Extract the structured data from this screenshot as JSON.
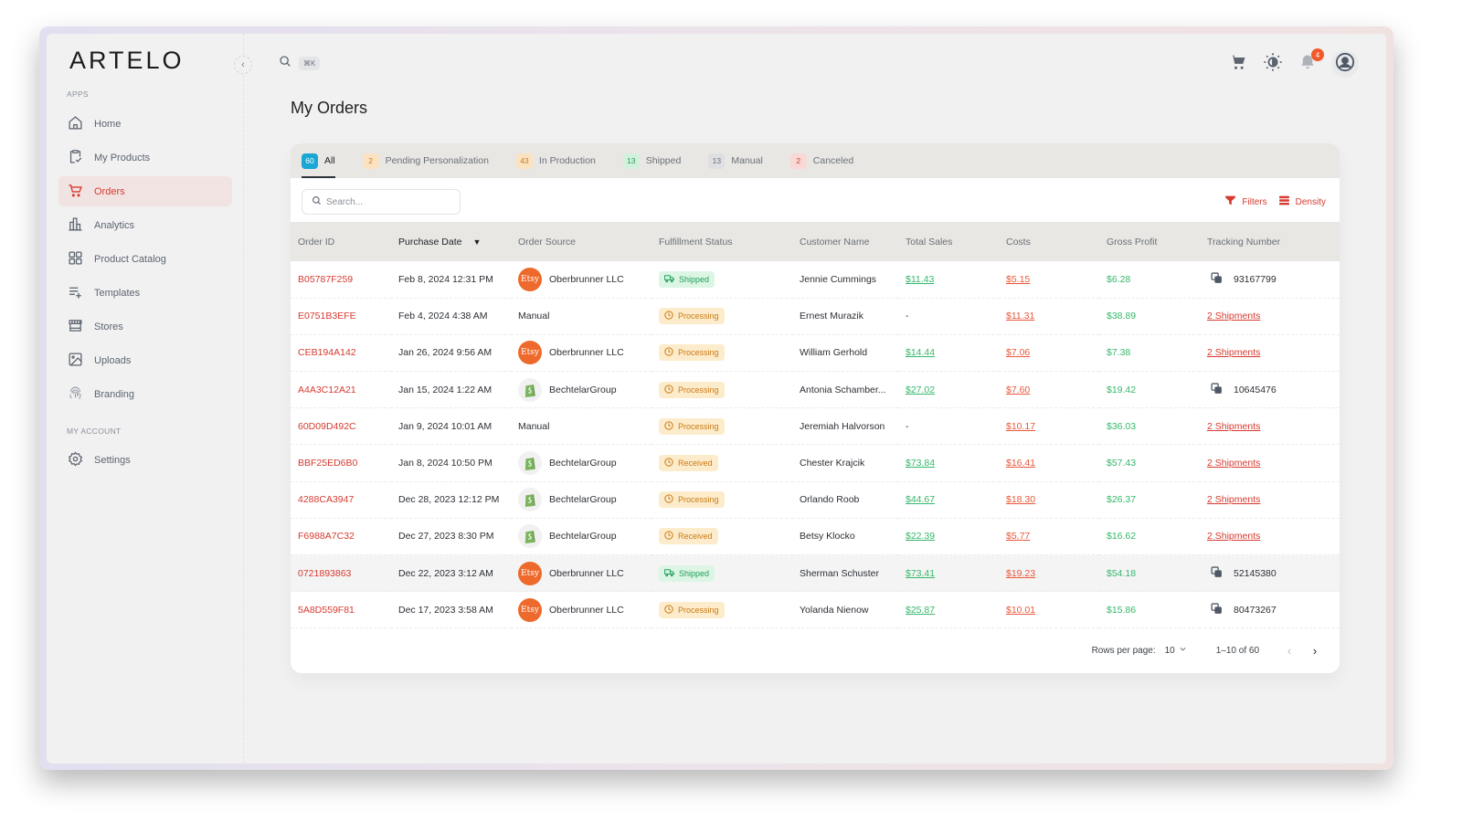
{
  "app": {
    "logo": "ARTELO",
    "search_shortcut": "⌘K",
    "notification_count": "4"
  },
  "sidebar": {
    "apps_label": "APPS",
    "account_label": "MY ACCOUNT",
    "items": [
      {
        "label": "Home",
        "icon": "home-icon"
      },
      {
        "label": "My Products",
        "icon": "clipboard-check-icon"
      },
      {
        "label": "Orders",
        "icon": "cart-icon",
        "active": true
      },
      {
        "label": "Analytics",
        "icon": "bar-chart-icon"
      },
      {
        "label": "Product Catalog",
        "icon": "grid-icon"
      },
      {
        "label": "Templates",
        "icon": "list-plus-icon"
      },
      {
        "label": "Stores",
        "icon": "storefront-icon"
      },
      {
        "label": "Uploads",
        "icon": "image-icon"
      },
      {
        "label": "Branding",
        "icon": "fingerprint-icon"
      }
    ],
    "account_items": [
      {
        "label": "Settings",
        "icon": "gear-icon"
      }
    ]
  },
  "page": {
    "title": "My Orders"
  },
  "tabs": [
    {
      "label": "All",
      "count": "60",
      "count_bg": "#1aa7d4",
      "count_color": "#ffffff",
      "active": true
    },
    {
      "label": "Pending Personalization",
      "count": "2",
      "count_bg": "#fbe3c2",
      "count_color": "#c97a17"
    },
    {
      "label": "In Production",
      "count": "43",
      "count_bg": "#fbe3c2",
      "count_color": "#c97a17"
    },
    {
      "label": "Shipped",
      "count": "13",
      "count_bg": "#d3f0dc",
      "count_color": "#22a05a"
    },
    {
      "label": "Manual",
      "count": "13",
      "count_bg": "#dedfe1",
      "count_color": "#6b7280"
    },
    {
      "label": "Canceled",
      "count": "2",
      "count_bg": "#f8d9d6",
      "count_color": "#d63a2f"
    }
  ],
  "toolbar": {
    "search_placeholder": "Search...",
    "filters_label": "Filters",
    "density_label": "Density"
  },
  "table": {
    "columns": [
      "Order ID",
      "Purchase Date",
      "Order Source",
      "Fulfillment Status",
      "Customer Name",
      "Total Sales",
      "Costs",
      "Gross Profit",
      "Tracking Number"
    ],
    "sorted_column": "Purchase Date",
    "rows": [
      {
        "order_id": "B05787F259",
        "date": "Feb 8, 2024 12:31 PM",
        "source": "Oberbrunner LLC",
        "source_type": "etsy",
        "status": "Shipped",
        "status_type": "shipped",
        "customer": "Jennie Cummings",
        "total": "$11.43",
        "costs": "$5.15",
        "profit": "$6.28",
        "tracking": "93167799",
        "tracking_type": "number"
      },
      {
        "order_id": "E0751B3EFE",
        "date": "Feb 4, 2024 4:38 AM",
        "source": "Manual",
        "source_type": "manual",
        "status": "Processing",
        "status_type": "processing",
        "customer": "Ernest Murazik",
        "total": "-",
        "costs": "$11.31",
        "profit": "$38.89",
        "tracking": "2 Shipments",
        "tracking_type": "link"
      },
      {
        "order_id": "CEB194A142",
        "date": "Jan 26, 2024 9:56 AM",
        "source": "Oberbrunner LLC",
        "source_type": "etsy",
        "status": "Processing",
        "status_type": "processing",
        "customer": "William Gerhold",
        "total": "$14.44",
        "costs": "$7.06",
        "profit": "$7.38",
        "tracking": "2 Shipments",
        "tracking_type": "link"
      },
      {
        "order_id": "A4A3C12A21",
        "date": "Jan 15, 2024 1:22 AM",
        "source": "BechtelarGroup",
        "source_type": "shopify",
        "status": "Processing",
        "status_type": "processing",
        "customer": "Antonia Schamber...",
        "total": "$27.02",
        "costs": "$7.60",
        "profit": "$19.42",
        "tracking": "10645476",
        "tracking_type": "number"
      },
      {
        "order_id": "60D09D492C",
        "date": "Jan 9, 2024 10:01 AM",
        "source": "Manual",
        "source_type": "manual",
        "status": "Processing",
        "status_type": "processing",
        "customer": "Jeremiah Halvorson",
        "total": "-",
        "costs": "$10.17",
        "profit": "$36.03",
        "tracking": "2 Shipments",
        "tracking_type": "link"
      },
      {
        "order_id": "BBF25ED6B0",
        "date": "Jan 8, 2024 10:50 PM",
        "source": "BechtelarGroup",
        "source_type": "shopify",
        "status": "Received",
        "status_type": "received",
        "customer": "Chester Krajcik",
        "total": "$73.84",
        "costs": "$16.41",
        "profit": "$57.43",
        "tracking": "2 Shipments",
        "tracking_type": "link"
      },
      {
        "order_id": "4288CA3947",
        "date": "Dec 28, 2023 12:12 PM",
        "source": "BechtelarGroup",
        "source_type": "shopify",
        "status": "Processing",
        "status_type": "processing",
        "customer": "Orlando Roob",
        "total": "$44.67",
        "costs": "$18.30",
        "profit": "$26.37",
        "tracking": "2 Shipments",
        "tracking_type": "link"
      },
      {
        "order_id": "F6988A7C32",
        "date": "Dec 27, 2023 8:30 PM",
        "source": "BechtelarGroup",
        "source_type": "shopify",
        "status": "Received",
        "status_type": "received",
        "customer": "Betsy Klocko",
        "total": "$22.39",
        "costs": "$5.77",
        "profit": "$16.62",
        "tracking": "2 Shipments",
        "tracking_type": "link"
      },
      {
        "order_id": "0721893863",
        "date": "Dec 22, 2023 3:12 AM",
        "source": "Oberbrunner LLC",
        "source_type": "etsy",
        "status": "Shipped",
        "status_type": "shipped",
        "customer": "Sherman Schuster",
        "total": "$73.41",
        "costs": "$19.23",
        "profit": "$54.18",
        "tracking": "52145380",
        "tracking_type": "number",
        "highlighted": true
      },
      {
        "order_id": "5A8D559F81",
        "date": "Dec 17, 2023 3:58 AM",
        "source": "Oberbrunner LLC",
        "source_type": "etsy",
        "status": "Processing",
        "status_type": "processing",
        "customer": "Yolanda Nienow",
        "total": "$25.87",
        "costs": "$10.01",
        "profit": "$15.86",
        "tracking": "80473267",
        "tracking_type": "number"
      }
    ]
  },
  "etsy_label": "Etsy",
  "pagination": {
    "rows_per_page_label": "Rows per page:",
    "rows_per_page": "10",
    "range": "1–10 of 60"
  }
}
